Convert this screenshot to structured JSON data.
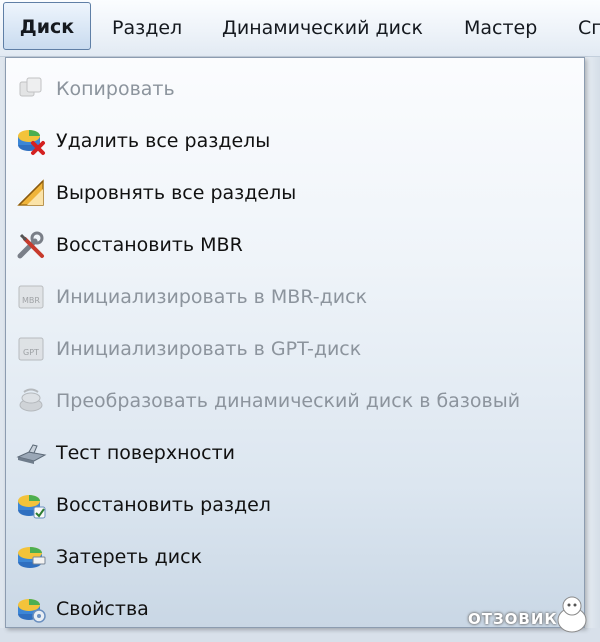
{
  "menubar": {
    "items": [
      {
        "label": "Диск",
        "active": true
      },
      {
        "label": "Раздел"
      },
      {
        "label": "Динамический диск"
      },
      {
        "label": "Мастер"
      },
      {
        "label": "Сп"
      }
    ]
  },
  "disk_menu": {
    "items": [
      {
        "label": "Копировать",
        "icon": "copy-icon",
        "enabled": false
      },
      {
        "label": "Удалить все разделы",
        "icon": "delete-partitions-icon",
        "enabled": true
      },
      {
        "label": "Выровнять все разделы",
        "icon": "align-icon",
        "enabled": true
      },
      {
        "label": "Восстановить MBR",
        "icon": "tools-icon",
        "enabled": true
      },
      {
        "label": "Инициализировать в MBR-диск",
        "icon": "mbr-disk-icon",
        "enabled": false
      },
      {
        "label": "Инициализировать в GPT-диск",
        "icon": "gpt-disk-icon",
        "enabled": false
      },
      {
        "label": "Преобразовать динамический диск в базовый",
        "icon": "convert-disk-icon",
        "enabled": false
      },
      {
        "label": "Тест поверхности",
        "icon": "surface-test-icon",
        "enabled": true
      },
      {
        "label": "Восстановить раздел",
        "icon": "recover-partition-icon",
        "enabled": true
      },
      {
        "label": "Затереть диск",
        "icon": "wipe-disk-icon",
        "enabled": true
      },
      {
        "label": "Свойства",
        "icon": "properties-icon",
        "enabled": true
      }
    ]
  },
  "watermark": {
    "text": "ОТЗОВИК"
  }
}
